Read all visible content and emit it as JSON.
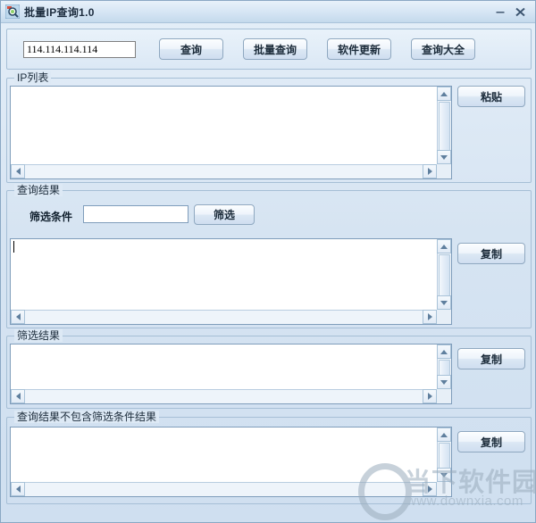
{
  "window": {
    "title": "批量IP查询1.0",
    "icon": "magnifier-icon",
    "minimize_label": "—",
    "close_label": "✕",
    "frame_color": "#8aa8c4",
    "background_color": "#dde9f5",
    "accent_color": "#7f9dbb"
  },
  "toolbar": {
    "ip_value": "114.114.114.114",
    "ip_placeholder": "",
    "query_label": "查询",
    "batch_query_label": "批量查询",
    "software_update_label": "软件更新",
    "query_all_label": "查询大全"
  },
  "ip_list": {
    "legend": "IP列表",
    "content": "",
    "paste_label": "粘贴"
  },
  "query_result": {
    "legend": "查询结果",
    "filter_label": "筛选条件",
    "filter_value": "",
    "filter_placeholder": "",
    "filter_button_label": "筛选",
    "content": "",
    "copy_label": "复制"
  },
  "filter_result": {
    "legend": "筛选结果",
    "content": "",
    "copy_label": "复制"
  },
  "excluded_result": {
    "legend": "查询结果不包含筛选条件结果",
    "content": "",
    "copy_label": "复制"
  },
  "watermark": {
    "brand": "当下软件园",
    "url": "www.downxia.com"
  }
}
